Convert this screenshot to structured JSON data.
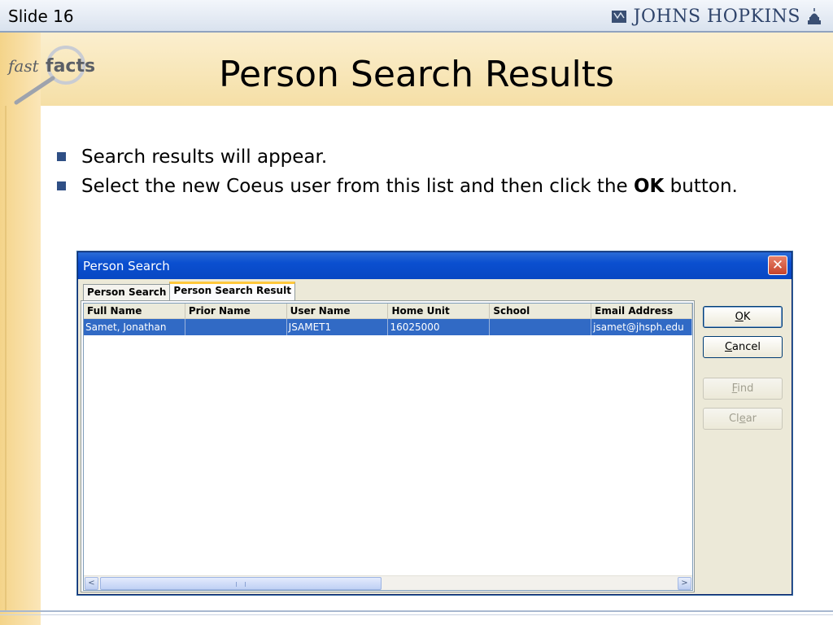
{
  "slide": {
    "number_label": "Slide 16",
    "brand": "JOHNS HOPKINS",
    "logo": {
      "word1": "fast",
      "word2": "facts"
    },
    "title": "Person Search Results",
    "bullets": [
      {
        "text": "Search results will appear."
      },
      {
        "text_before": "Select the new Coeus user from this list and then click the ",
        "bold": "OK",
        "text_after": " button."
      }
    ]
  },
  "window": {
    "title": "Person Search",
    "close_glyph": "✕",
    "tabs": [
      {
        "label": "Person Search",
        "active": false
      },
      {
        "label": "Person Search Result",
        "active": true
      }
    ],
    "table": {
      "columns": [
        "Full Name",
        "Prior Name",
        "User Name",
        "Home Unit",
        "School",
        "Email Address"
      ],
      "rows": [
        {
          "full_name": "Samet, Jonathan",
          "prior_name": "",
          "user_name": "JSAMET1",
          "home_unit": "16025000",
          "school": "",
          "email": "jsamet@jhsph.edu",
          "selected": true
        }
      ]
    },
    "scroll": {
      "left_glyph": "<",
      "right_glyph": ">"
    },
    "buttons": {
      "ok": {
        "mnemonic": "O",
        "rest": "K",
        "enabled": true
      },
      "cancel": {
        "mnemonic": "C",
        "rest": "ancel",
        "enabled": true
      },
      "find": {
        "mnemonic": "F",
        "rest": "ind",
        "enabled": false
      },
      "clear": {
        "pre": "Cl",
        "mnemonic": "e",
        "rest": "ar",
        "enabled": false
      }
    }
  },
  "colors": {
    "titlebar": "#0a4fd0",
    "selection": "#316ac5",
    "tab_highlight": "#ffc83c",
    "title_band": "#f5dfa6",
    "bullet": "#2f4f85"
  }
}
